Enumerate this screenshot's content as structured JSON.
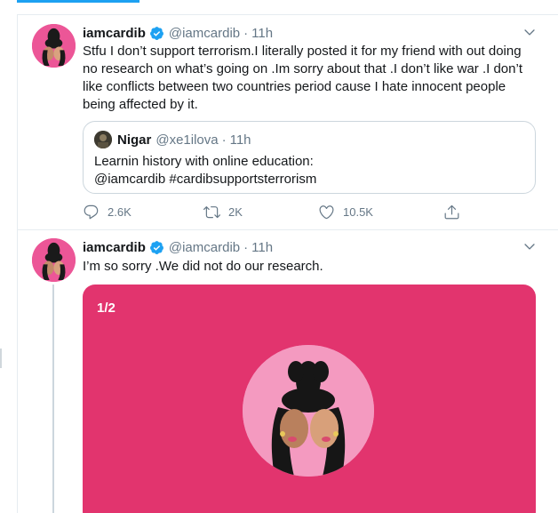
{
  "tweets": [
    {
      "display_name": "iamcardib",
      "handle": "@iamcardib",
      "separator": "·",
      "time": "11h",
      "text": "Stfu I don’t support terrorism.I literally posted it for my friend with out doing no research on what’s going on .Im sorry about that .I don’t like war .I don’t like conflicts between two countries period cause I hate innocent people being affected by it.",
      "quote": {
        "display_name": "Nigar",
        "handle": "@xe1ilova",
        "separator": "·",
        "time": "11h",
        "text_line1": "Learnin history with online education:",
        "text_line2": "@iamcardib #cardibsupportsterrorism"
      },
      "actions": {
        "replies": "2.6K",
        "retweets": "2K",
        "likes": "10.5K"
      }
    },
    {
      "display_name": "iamcardib",
      "handle": "@iamcardib",
      "separator": "·",
      "time": "11h",
      "text": "I’m so sorry .We did not do our research.",
      "media": {
        "counter": "1/2",
        "background_color": "#e2346e"
      }
    }
  ],
  "icons": {
    "verified": "verified-badge-icon",
    "caret": "chevron-down-icon",
    "reply": "reply-icon",
    "retweet": "retweet-icon",
    "like": "heart-icon",
    "share": "share-icon"
  },
  "colors": {
    "accent": "#1da1f2",
    "secondary_text": "#657786",
    "border": "#e6ecf0"
  }
}
